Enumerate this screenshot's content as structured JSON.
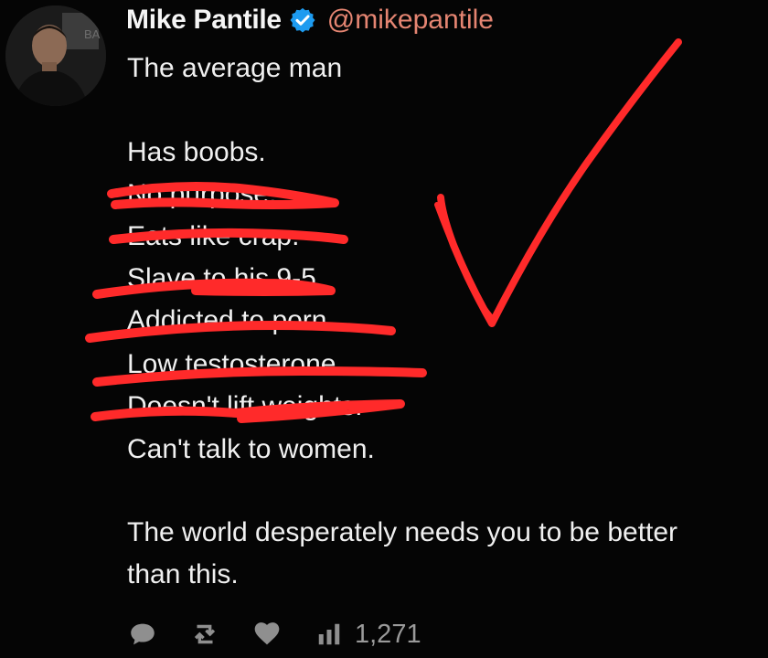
{
  "author": {
    "display_name": "Mike Pantile",
    "handle": "@mikepantile",
    "verified": true,
    "avatar_icon": "profile-photo"
  },
  "tweet": {
    "lines": [
      "The average man",
      "Has boobs.",
      "No purpose.",
      "Eats like crap.",
      "Slave to his 9-5.",
      "Addicted to porn.",
      "Low testosterone.",
      "Doesn't lift weights.",
      "Can't talk to women.",
      "The world desperately needs you to be better",
      "than this."
    ]
  },
  "annotations": {
    "strike_color": "#ff2a2a",
    "checkmark_color": "#ff2a2a",
    "checkmark_icon": "checkmark"
  },
  "actions": {
    "reply_icon": "reply-icon",
    "retweet_icon": "retweet-icon",
    "like_icon": "heart-icon",
    "views_icon": "bar-chart-icon",
    "views_count": "1,271"
  },
  "colors": {
    "background": "#050505",
    "handle": "#e58572",
    "verified_badge": "#1d9bf0",
    "icons": "#8f8f8f"
  }
}
